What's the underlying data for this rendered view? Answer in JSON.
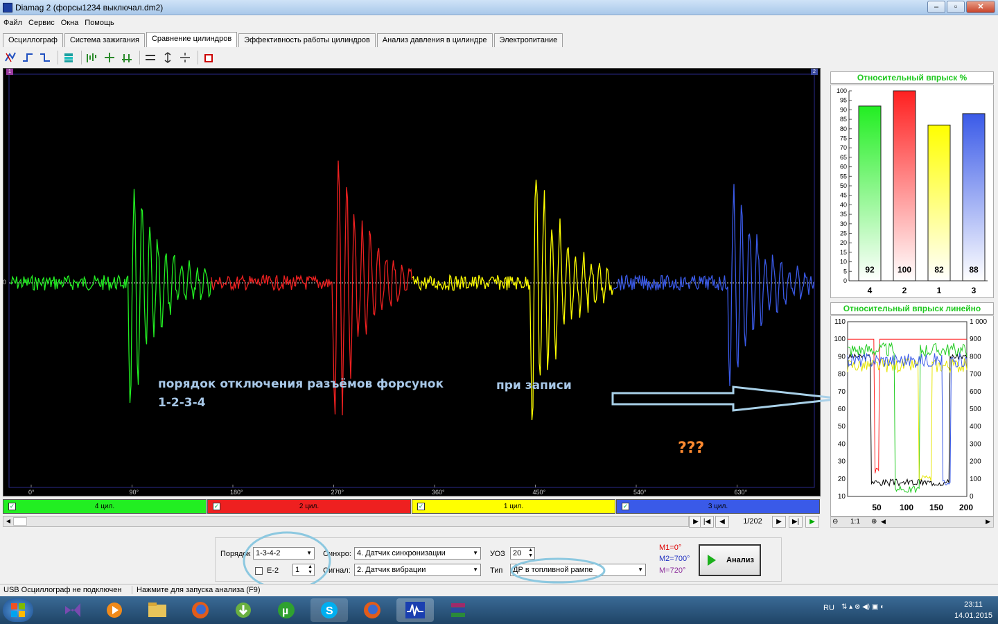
{
  "window": {
    "title": "Diamag 2 (форсы1234 выключал.dm2)",
    "buttons": [
      "–",
      "▫",
      "✕"
    ]
  },
  "menu": [
    "Файл",
    "Сервис",
    "Окна",
    "Помощь"
  ],
  "tabs": [
    {
      "label": "Осциллограф",
      "active": false
    },
    {
      "label": "Система зажигания",
      "active": false
    },
    {
      "label": "Сравнение цилиндров",
      "active": true
    },
    {
      "label": "Эффективность работы цилиндров",
      "active": false
    },
    {
      "label": "Анализ давления в цилиндре",
      "active": false
    },
    {
      "label": "Электропитание",
      "active": false
    }
  ],
  "scope": {
    "zero_label": "0",
    "marker_left": "1",
    "marker_right": "2",
    "x_ticks": [
      "0°",
      "90°",
      "180°",
      "270°",
      "360°",
      "450°",
      "540°",
      "630°"
    ],
    "annotation_line1": "порядок отключения разъёмов форсунок",
    "annotation_line2": "1-2-3-4",
    "annotation_record": "при записи",
    "annotation_question": "???"
  },
  "cylinders": [
    {
      "label": "4 цил.",
      "color": "#22ee22",
      "checked": true
    },
    {
      "label": "2 цил.",
      "color": "#ee2020",
      "checked": true
    },
    {
      "label": "1 цил.",
      "color": "#ffff00",
      "checked": true
    },
    {
      "label": "3 цил.",
      "color": "#3a5ae8",
      "checked": true
    }
  ],
  "nav": {
    "page": "1/202"
  },
  "bar_chart": {
    "title": "Относительный впрыск %",
    "categories": [
      "4",
      "2",
      "1",
      "3"
    ],
    "values": [
      92,
      100,
      82,
      88
    ],
    "colors": [
      "#22ee22",
      "#ff2020",
      "#ffff00",
      "#3a5ae8"
    ],
    "ylim": [
      0,
      100
    ],
    "y_ticks": [
      "100",
      "95",
      "90",
      "85",
      "80",
      "75",
      "70",
      "65",
      "60",
      "55",
      "50",
      "45",
      "40",
      "35",
      "30",
      "25",
      "20",
      "15",
      "10",
      "5",
      "0"
    ]
  },
  "line_chart": {
    "title": "Относительный впрыск линейно",
    "y_left_ticks": [
      "110",
      "100",
      "90",
      "80",
      "70",
      "60",
      "50",
      "40",
      "30",
      "20",
      "10"
    ],
    "y_right_ticks": [
      "1 000",
      "900",
      "800",
      "700",
      "600",
      "500",
      "400",
      "300",
      "200",
      "100",
      "0"
    ],
    "x_ticks": [
      "50",
      "100",
      "150",
      "200"
    ],
    "zoom_label": "1:1"
  },
  "chart_data": {
    "type": "bar",
    "title": "Относительный впрыск %",
    "categories": [
      "4",
      "2",
      "1",
      "3"
    ],
    "values": [
      92,
      100,
      82,
      88
    ],
    "ylim": [
      0,
      100
    ]
  },
  "form": {
    "order_label": "Порядок",
    "order_value": "1-3-4-2",
    "e2_label": "E-2",
    "e2_value": "1",
    "sync_label": "Синхро:",
    "sync_value": "4. Датчик синхронизации",
    "signal_label": "Сигнал:",
    "signal_value": "2. Датчик вибрации",
    "uoz_label": "УОЗ",
    "uoz_value": "20",
    "type_label": "Тип",
    "type_value": "ДР в топливной рампе",
    "m1": "M1=0°",
    "m2": "M2=700°",
    "m3": "M=720°",
    "analyze_label": "Анализ"
  },
  "status": {
    "left": "USB Осциллограф не подключен",
    "right": "Нажмите для запуска анализа (F9)"
  },
  "taskbar": {
    "lang": "RU",
    "time": "23:11",
    "date": "14.01.2015"
  }
}
